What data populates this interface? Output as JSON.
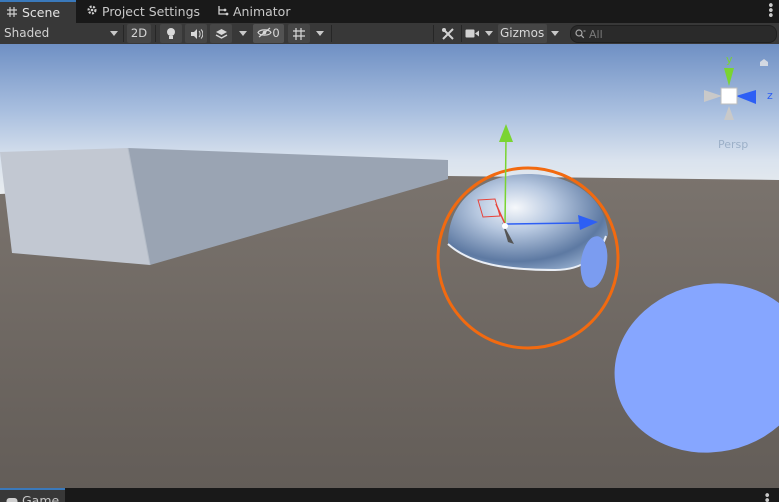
{
  "tabs": [
    {
      "label": "Scene",
      "icon": "hash-grid-icon",
      "active": true
    },
    {
      "label": "Project Settings",
      "icon": "gear-icon",
      "active": false
    },
    {
      "label": "Animator",
      "icon": "animator-icon",
      "active": false
    }
  ],
  "toolbar": {
    "shading_mode": "Shaded",
    "mode_2d": "2D",
    "hidden_count": "0",
    "gizmos_label": "Gizmos",
    "search_placeholder": "All"
  },
  "scene_gizmo": {
    "y_label": "y",
    "z_label": "z",
    "projection_label": "Persp"
  },
  "bottom_panel": {
    "tab_label": "Game"
  },
  "colors": {
    "accent_tab": "#3a79bb",
    "selection_outline": "#f26a10",
    "axis_x": "#e8433a",
    "axis_y": "#7ad431",
    "axis_z": "#2d5ff5",
    "sky_top": "#6f90c4",
    "ground": "#6b645e",
    "light_blue_shape": "#86a6ff"
  }
}
